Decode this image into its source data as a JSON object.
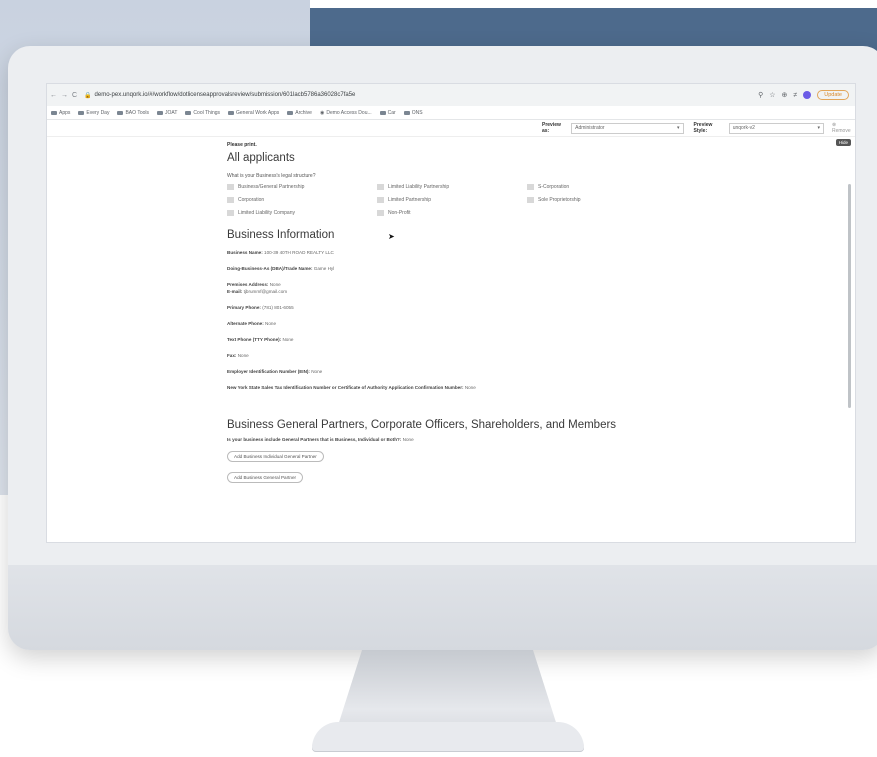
{
  "browser": {
    "url": "demo-pex.unqork.io/#/workflow/dotlicenseapprovalsreview/submission/601lacb5786a36028c7fa5e",
    "update_label": "Update",
    "bookmarks": [
      "Apps",
      "Every Day",
      "BAO Tools",
      "JOAT",
      "Cool Things",
      "General Work Apps",
      "Archive",
      "Demo Access Dou...",
      "Car",
      "ONS"
    ]
  },
  "preview_bar": {
    "preview_as_label": "Preview as:",
    "preview_as_value": "Administrator",
    "preview_style_label": "Preview Style:",
    "preview_style_value": "unqork-v2",
    "remove_label": "Remove",
    "hide_label": "Hide"
  },
  "form": {
    "please_print": "Please print.",
    "section1_title": "All applicants",
    "legal_question": "What is your Business's legal structure?",
    "legal_options": [
      "Business/General Partnership",
      "Limited Liability Partnership",
      "S-Corporation",
      "Corporation",
      "Limited Partnership",
      "Sole Proprietorship",
      "Limited Liability Company",
      "Non-Profit"
    ],
    "section2_title": "Business Information",
    "business_name_label": "Business Name:",
    "business_name_value": "100-39 40TH ROAD REALTY LLC",
    "dba_label": "Doing-Business-As (DBA)/Trade Name:",
    "dba_value": "Game Hyl",
    "premises_label": "Premises Address:",
    "premises_value": "None",
    "email_label": "E-mail:",
    "email_value": "tjbrummf@gmail.com",
    "primary_phone_label": "Primary Phone:",
    "primary_phone_value": "(781) 801-6055",
    "alt_phone_label": "Alternate Phone:",
    "alt_phone_value": "None",
    "tty_label": "Text Phone (TTY Phone):",
    "tty_value": "None",
    "fax_label": "Fax:",
    "fax_value": "None",
    "ein_label": "Employer Identification Number (EIN):",
    "ein_value": "None",
    "tax_label": "New York State Sales Tax Identification Number or Certificate of Authority Application Confirmation Number:",
    "tax_value": "None",
    "section3_title": "Business General Partners, Corporate Officers, Shareholders, and Members",
    "partners_question": "Is your business include General Partners that is Business, Individual or Both?:",
    "partners_value": "None",
    "btn_individual_partner": "Add Business Individual General Partner",
    "btn_general_partner": "Add Business General Partner"
  }
}
